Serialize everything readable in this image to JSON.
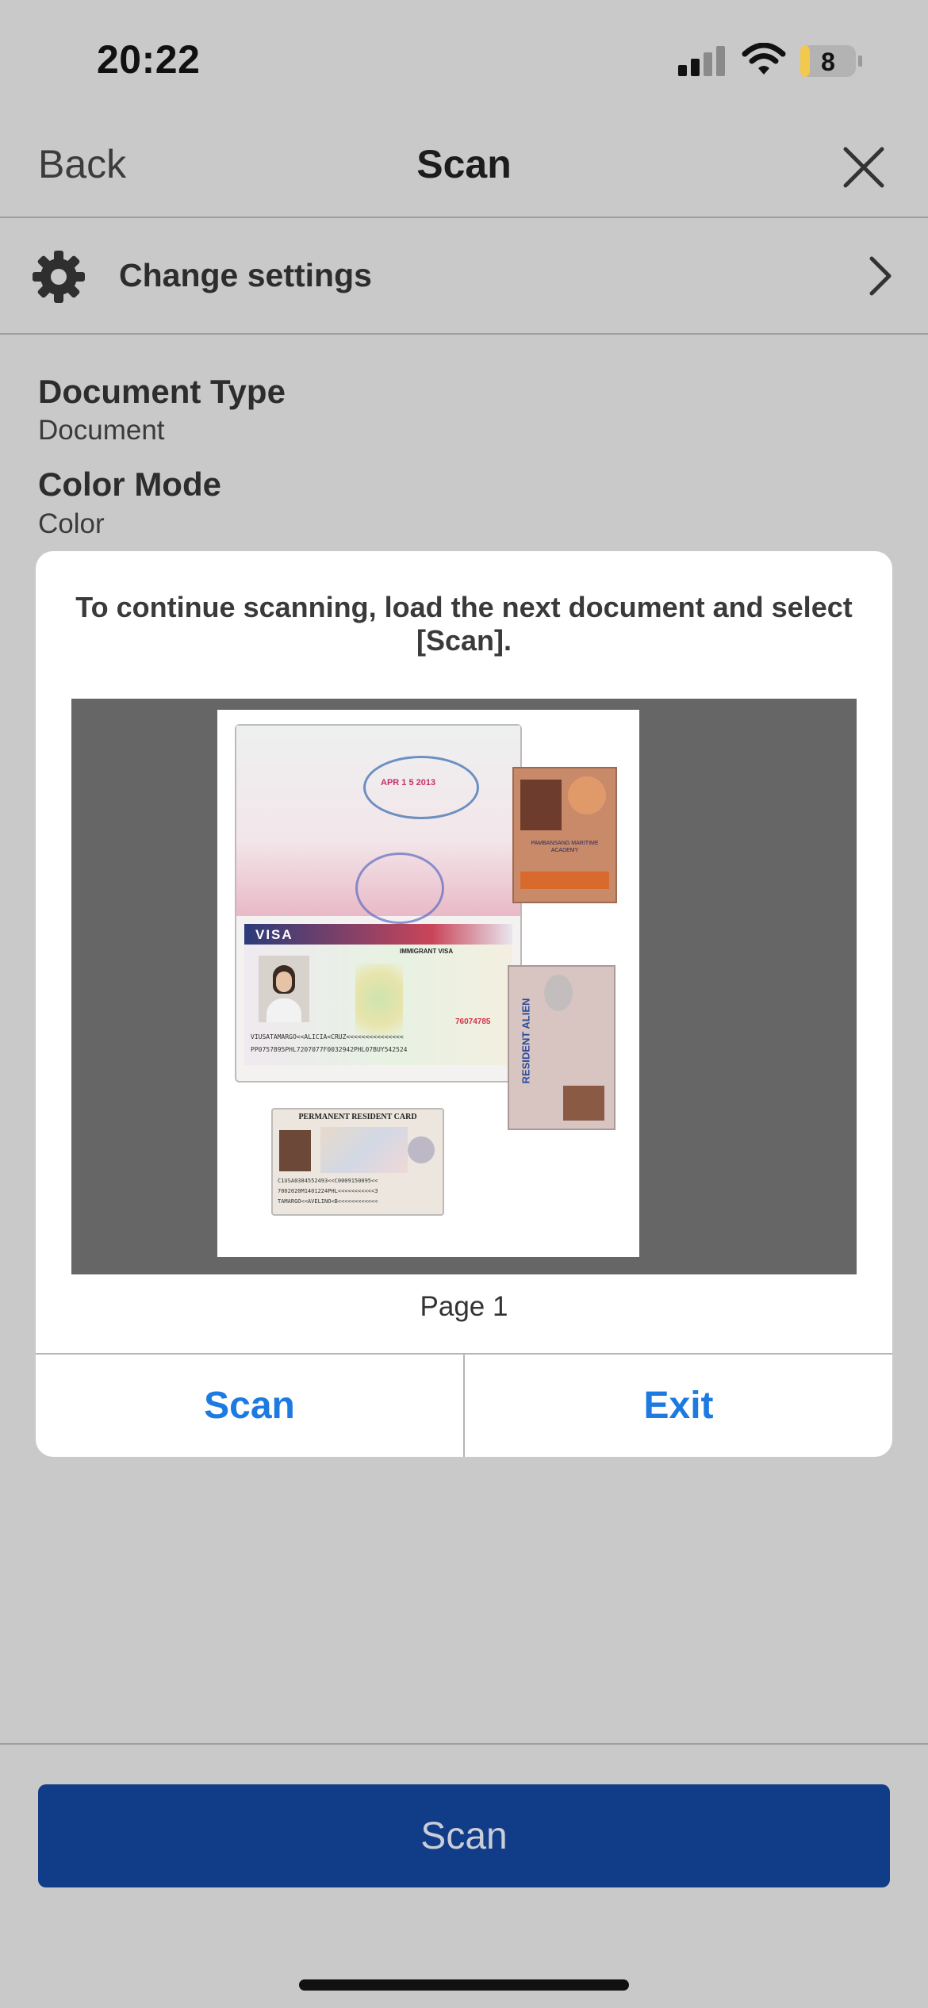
{
  "status_bar": {
    "time": "20:22",
    "battery_level": "8"
  },
  "nav": {
    "back_label": "Back",
    "title": "Scan",
    "close_icon": "close-icon"
  },
  "settings_row": {
    "label": "Change settings",
    "icon": "gear-icon",
    "chevron": "chevron-right-icon"
  },
  "info": [
    {
      "label": "Document Type",
      "value": "Document"
    },
    {
      "label": "Color Mode",
      "value": "Color"
    }
  ],
  "dialog": {
    "message": "To continue scanning, load the next document and select [Scan].",
    "preview": {
      "page_label": "Page 1",
      "stamp_text": "APR 1 5 2013",
      "visa_label": "VISA",
      "visa_type": "IMMIGRANT VISA",
      "visa_number": "76074785",
      "mrz_line1": "VIUSATAMARGO<<ALICIA<CRUZ<<<<<<<<<<<<<<<",
      "mrz_line2": "PP0757895PHL7207077F0032942PHL07BUY542524",
      "green_card_title": "PERMANENT RESIDENT CARD",
      "green_card_mrz1": "C1USA0384552493<<C0009150095<<",
      "green_card_mrz2": "7002020M1401224PHL<<<<<<<<<<<3",
      "green_card_mrz3": "TAMARGO<<AVELINO<B<<<<<<<<<<<<",
      "alien_card_title": "RESIDENT ALIEN",
      "maritime_card_text": "PAMBANSANG MARITIME ACADEMY"
    },
    "buttons": {
      "scan": "Scan",
      "exit": "Exit"
    }
  },
  "primary_button": {
    "label": "Scan"
  },
  "colors": {
    "primary_button": "#113c88",
    "dialog_button_text": "#1c7ae0",
    "background": "#c9c9c9"
  }
}
